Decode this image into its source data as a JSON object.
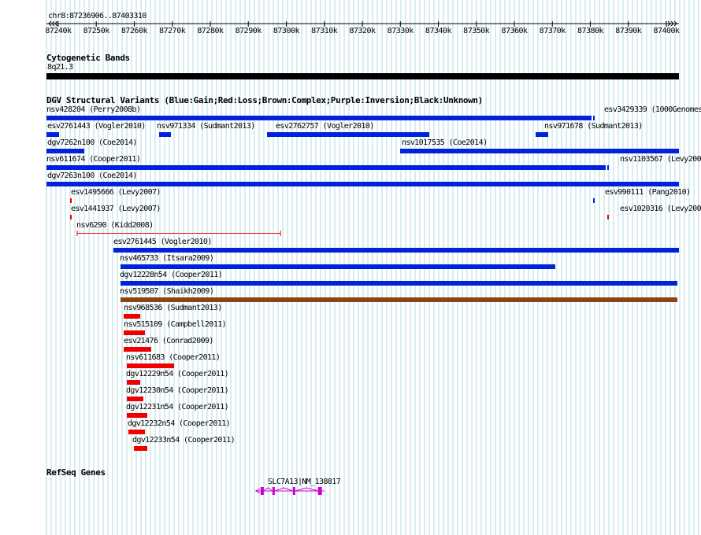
{
  "ruler": {
    "range": "chr8:87236906..87403310",
    "ticks": [
      "87240k",
      "87250k",
      "87260k",
      "87270k",
      "87280k",
      "87290k",
      "87300k",
      "87310k",
      "87320k",
      "87330k",
      "87340k",
      "87350k",
      "87360k",
      "87370k",
      "87380k",
      "87390k",
      "87400k"
    ]
  },
  "cyto": {
    "title": "Cytogenetic Bands",
    "band": "8q21.3"
  },
  "dgv": {
    "title": "DGV Structural Variants (Blue:Gain;Red:Loss;Brown:Complex;Purple:Inversion;Black:Unknown)"
  },
  "colors": {
    "gain": "#0022dd",
    "loss": "#ee0000",
    "complex": "#8b4513",
    "gene": "#cc00cc",
    "grid": "#b3dbe3"
  },
  "variants": [
    {
      "label": "nsv428204 (Perry2008b)",
      "type": "gain",
      "start": 87236906,
      "end": 87380400
    },
    {
      "label": "esv3429339 (1000Genomes)",
      "type": "gain",
      "start": 87380700,
      "end": 87381000
    },
    {
      "label": "esv2761443 (Vogler2010)",
      "type": "gain",
      "start": 87237000,
      "end": 87240300
    },
    {
      "label": "nsv971334 (Sudmant2013)",
      "type": "gain",
      "start": 87266500,
      "end": 87269600
    },
    {
      "label": "esv2762757 (Vogler2010)",
      "type": "gain",
      "start": 87295000,
      "end": 87337700
    },
    {
      "label": "nsv971678 (Sudmant2013)",
      "type": "gain",
      "start": 87365500,
      "end": 87369000
    },
    {
      "label": "dgv7262n100 (Coe2014)",
      "type": "gain",
      "start": 87237000,
      "end": 87246800
    },
    {
      "label": "nsv1017535 (Coe2014)",
      "type": "gain",
      "start": 87330000,
      "end": 87403310
    },
    {
      "label": "nsv611674 (Cooper2011)",
      "type": "gain",
      "start": 87237000,
      "end": 87384000
    },
    {
      "label": "nsv1103567 (Levy2007)",
      "type": "gain",
      "start": 87384400,
      "end": 87384700
    },
    {
      "label": "dgv7263n100 (Coe2014)",
      "type": "gain",
      "start": 87237000,
      "end": 87403310
    },
    {
      "label": "esv1495666 (Levy2007)",
      "type": "loss",
      "start": 87243200,
      "end": 87243500
    },
    {
      "label": "esv990111 (Pang2010)",
      "type": "gain",
      "start": 87380700,
      "end": 87381000
    },
    {
      "label": "esv1441937 (Levy2007)",
      "type": "loss",
      "start": 87243200,
      "end": 87243500
    },
    {
      "label": "esv1020316 (Levy2007)",
      "type": "loss",
      "start": 87384400,
      "end": 87384700
    },
    {
      "label": "nsv6290 (Kidd2008)",
      "type": "loss-range",
      "start": 87245000,
      "end": 87298500
    },
    {
      "label": "esv2761445 (Vogler2010)",
      "type": "gain",
      "start": 87254600,
      "end": 87403310
    },
    {
      "label": "nsv465733 (Itsara2009)",
      "type": "gain",
      "start": 87256300,
      "end": 87370700
    },
    {
      "label": "dgv12228n54 (Cooper2011)",
      "type": "gain",
      "start": 87256300,
      "end": 87403000
    },
    {
      "label": "nsv519507 (Shaikh2009)",
      "type": "complex",
      "start": 87256300,
      "end": 87403000
    },
    {
      "label": "nsv968536 (Sudmant2013)",
      "type": "loss",
      "start": 87257300,
      "end": 87261600
    },
    {
      "label": "nsv515109 (Campbell2011)",
      "type": "loss",
      "start": 87257300,
      "end": 87262900
    },
    {
      "label": "esv21476 (Conrad2009)",
      "type": "loss",
      "start": 87257300,
      "end": 87264500
    },
    {
      "label": "nsv611683 (Cooper2011)",
      "type": "loss",
      "start": 87258000,
      "end": 87270500
    },
    {
      "label": "dgv12229n54 (Cooper2011)",
      "type": "loss",
      "start": 87258000,
      "end": 87261600
    },
    {
      "label": "dgv12230n54 (Cooper2011)",
      "type": "loss",
      "start": 87258000,
      "end": 87262300
    },
    {
      "label": "dgv12231n54 (Cooper2011)",
      "type": "loss",
      "start": 87258000,
      "end": 87263500
    },
    {
      "label": "dgv12232n54 (Cooper2011)",
      "type": "loss",
      "start": 87258400,
      "end": 87262900
    },
    {
      "label": "dgv12233n54 (Cooper2011)",
      "type": "loss",
      "start": 87260000,
      "end": 87263500
    }
  ],
  "refseq": {
    "title": "RefSeq Genes",
    "gene_label": "SLC7A13|NM_138817",
    "start": 87292000,
    "end": 87310000
  }
}
